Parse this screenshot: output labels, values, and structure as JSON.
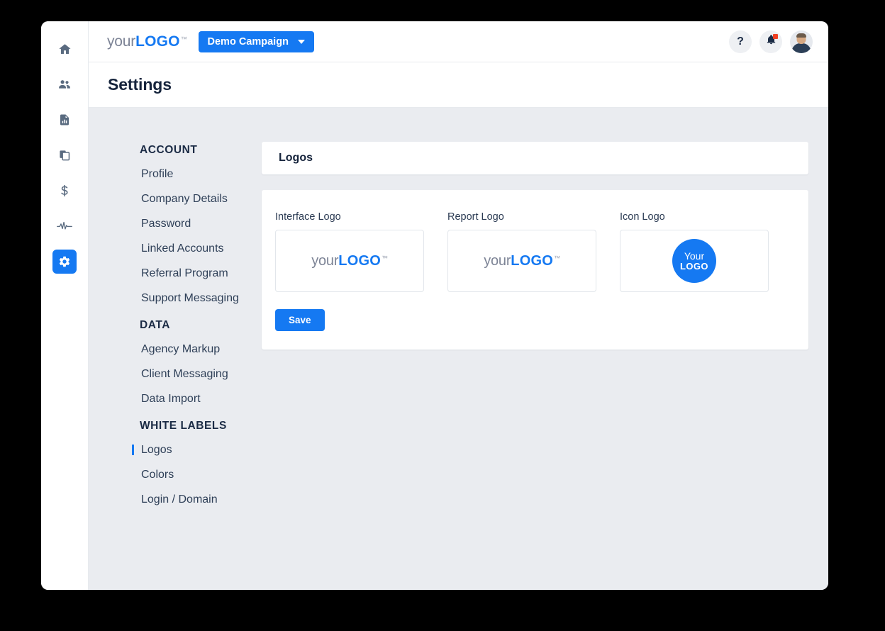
{
  "window": {
    "title": "Settings"
  },
  "rail": {
    "items": [
      {
        "name": "home-icon",
        "label": "Home",
        "active": false
      },
      {
        "name": "users-icon",
        "label": "Clients",
        "active": false
      },
      {
        "name": "report-icon",
        "label": "Reports",
        "active": false
      },
      {
        "name": "documents-icon",
        "label": "Documents",
        "active": false
      },
      {
        "name": "dollar-icon",
        "label": "Billing",
        "active": false
      },
      {
        "name": "pulse-icon",
        "label": "Activity",
        "active": false
      },
      {
        "name": "gear-icon",
        "label": "Settings",
        "active": true
      }
    ]
  },
  "topbar": {
    "brand": {
      "prefix": "your",
      "strong": "LOGO",
      "tm": "™"
    },
    "campaign_button": "Demo Campaign",
    "help_label": "?",
    "notification_count": 1
  },
  "settings_nav": {
    "groups": [
      {
        "title": "ACCOUNT",
        "items": [
          {
            "label": "Profile",
            "active": false
          },
          {
            "label": "Company Details",
            "active": false
          },
          {
            "label": "Password",
            "active": false
          },
          {
            "label": "Linked Accounts",
            "active": false
          },
          {
            "label": "Referral Program",
            "active": false
          },
          {
            "label": "Support Messaging",
            "active": false
          }
        ]
      },
      {
        "title": "DATA",
        "items": [
          {
            "label": "Agency Markup",
            "active": false
          },
          {
            "label": "Client Messaging",
            "active": false
          },
          {
            "label": "Data Import",
            "active": false
          }
        ]
      },
      {
        "title": "WHITE LABELS",
        "items": [
          {
            "label": "Logos",
            "active": true
          },
          {
            "label": "Colors",
            "active": false
          },
          {
            "label": "Login / Domain",
            "active": false
          }
        ]
      }
    ]
  },
  "logos_panel": {
    "header_title": "Logos",
    "slots": [
      {
        "label": "Interface Logo",
        "type": "wordmark",
        "prefix": "your",
        "strong": "LOGO",
        "tm": "™"
      },
      {
        "label": "Report Logo",
        "type": "wordmark",
        "prefix": "your",
        "strong": "LOGO",
        "tm": "™"
      },
      {
        "label": "Icon Logo",
        "type": "badge",
        "prefix": "Your",
        "strong": "LOGO"
      }
    ],
    "save_label": "Save"
  },
  "colors": {
    "accent": "#1579f2",
    "page_background": "#eaecf0",
    "panel_background": "#ffffff",
    "text_dark": "#16243c",
    "text_body": "#2e3f57",
    "rail_icon": "#5a6b80",
    "badge_red": "#f04124",
    "border": "#e2e6eb"
  }
}
